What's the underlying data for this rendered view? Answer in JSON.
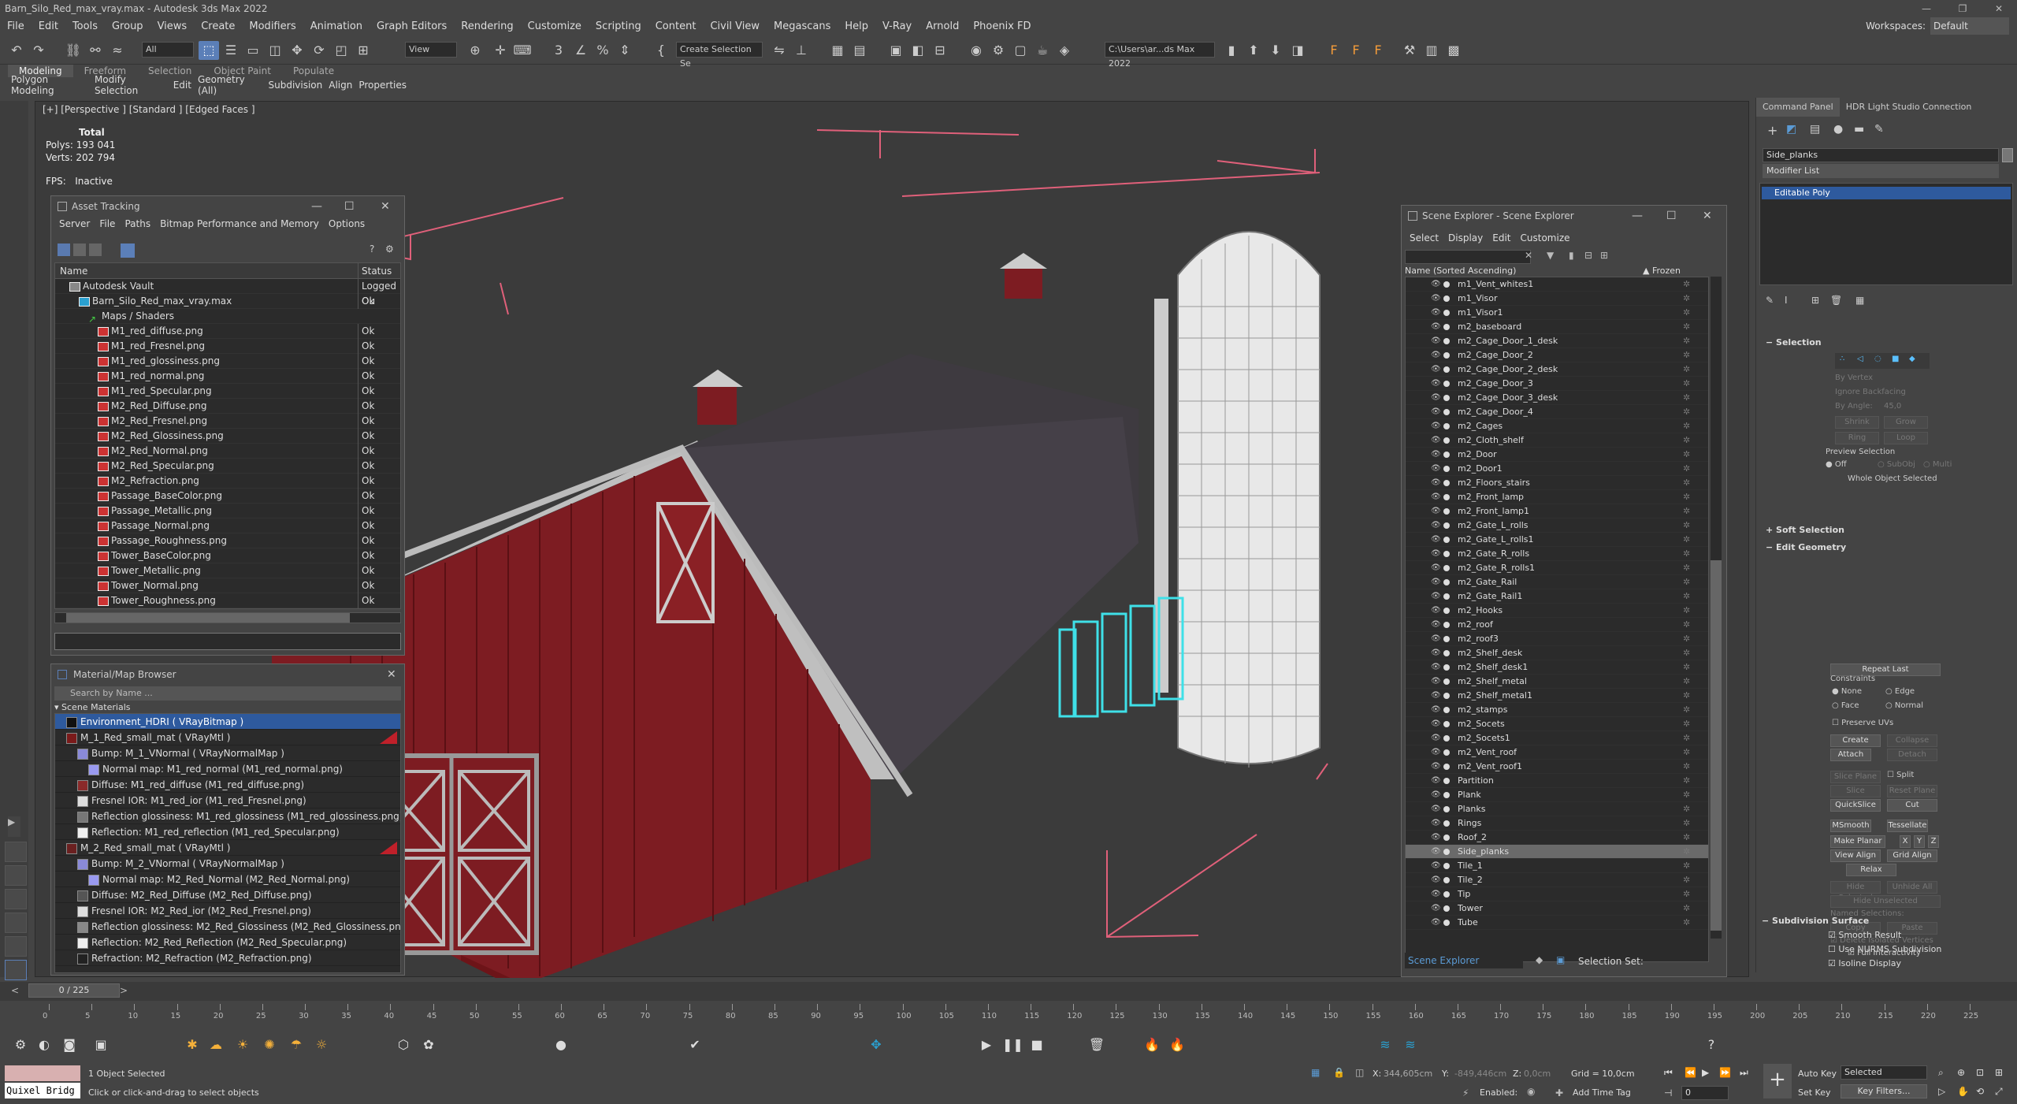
{
  "window": {
    "title": "Barn_Silo_Red_max_vray.max - Autodesk 3ds Max 2022",
    "minimize": "—",
    "maximize": "❐",
    "close": "✕"
  },
  "menu": [
    "File",
    "Edit",
    "Tools",
    "Group",
    "Views",
    "Create",
    "Modifiers",
    "Animation",
    "Graph Editors",
    "Rendering",
    "Customize",
    "Scripting",
    "Content",
    "Civil View",
    "Megascans",
    "Help",
    "V-Ray",
    "Arnold",
    "Phoenix FD"
  ],
  "workspace": {
    "label": "Workspaces:",
    "value": "Default"
  },
  "toolbar": {
    "filter": "All",
    "view": "View",
    "selection_set": "Create Selection Se",
    "path": "C:\\Users\\ar...ds Max 2022"
  },
  "ribbon": {
    "tabs": [
      "Modeling",
      "Freeform",
      "Selection",
      "Object Paint",
      "Populate"
    ],
    "sub": [
      "Polygon Modeling",
      "Modify Selection",
      "Edit",
      "Geometry (All)",
      "Subdivision",
      "Align",
      "Properties"
    ]
  },
  "viewport": {
    "label": "[+] [Perspective ] [Standard ] [Edged Faces ]",
    "stats": {
      "header": "Total",
      "polys_label": "Polys:",
      "polys": "193 041",
      "verts_label": "Verts:",
      "verts": "202 794",
      "fps_label": "FPS:",
      "fps": "Inactive"
    }
  },
  "asset_tracking": {
    "title": "Asset Tracking",
    "menu": [
      "Server",
      "File",
      "Paths",
      "Bitmap Performance and Memory",
      "Options"
    ],
    "col_name": "Name",
    "col_status": "Status",
    "rows": [
      {
        "name": "Autodesk Vault",
        "status": "Logged Ou",
        "indent": 18,
        "type": "vault"
      },
      {
        "name": "Barn_Silo_Red_max_vray.max",
        "status": "Ok",
        "indent": 30,
        "type": "max"
      },
      {
        "name": "Maps / Shaders",
        "status": "",
        "indent": 42,
        "type": "folder"
      },
      {
        "name": "M1_red_diffuse.png",
        "status": "Ok",
        "indent": 54,
        "type": "file"
      },
      {
        "name": "M1_red_Fresnel.png",
        "status": "Ok",
        "indent": 54,
        "type": "file"
      },
      {
        "name": "M1_red_glossiness.png",
        "status": "Ok",
        "indent": 54,
        "type": "file"
      },
      {
        "name": "M1_red_normal.png",
        "status": "Ok",
        "indent": 54,
        "type": "file"
      },
      {
        "name": "M1_red_Specular.png",
        "status": "Ok",
        "indent": 54,
        "type": "file"
      },
      {
        "name": "M2_Red_Diffuse.png",
        "status": "Ok",
        "indent": 54,
        "type": "file"
      },
      {
        "name": "M2_Red_Fresnel.png",
        "status": "Ok",
        "indent": 54,
        "type": "file"
      },
      {
        "name": "M2_Red_Glossiness.png",
        "status": "Ok",
        "indent": 54,
        "type": "file"
      },
      {
        "name": "M2_Red_Normal.png",
        "status": "Ok",
        "indent": 54,
        "type": "file"
      },
      {
        "name": "M2_Red_Specular.png",
        "status": "Ok",
        "indent": 54,
        "type": "file"
      },
      {
        "name": "M2_Refraction.png",
        "status": "Ok",
        "indent": 54,
        "type": "file"
      },
      {
        "name": "Passage_BaseColor.png",
        "status": "Ok",
        "indent": 54,
        "type": "file"
      },
      {
        "name": "Passage_Metallic.png",
        "status": "Ok",
        "indent": 54,
        "type": "file"
      },
      {
        "name": "Passage_Normal.png",
        "status": "Ok",
        "indent": 54,
        "type": "file"
      },
      {
        "name": "Passage_Roughness.png",
        "status": "Ok",
        "indent": 54,
        "type": "file"
      },
      {
        "name": "Tower_BaseColor.png",
        "status": "Ok",
        "indent": 54,
        "type": "file"
      },
      {
        "name": "Tower_Metallic.png",
        "status": "Ok",
        "indent": 54,
        "type": "file"
      },
      {
        "name": "Tower_Normal.png",
        "status": "Ok",
        "indent": 54,
        "type": "file"
      },
      {
        "name": "Tower_Roughness.png",
        "status": "Ok",
        "indent": 54,
        "type": "file"
      }
    ]
  },
  "material_browser": {
    "title": "Material/Map Browser",
    "search": "Search by Name ...",
    "group": "Scene Materials",
    "rows": [
      {
        "text": "Environment_HDRI  ( VRayBitmap )",
        "indent": 14,
        "swatch": "#111111",
        "sel": true
      },
      {
        "text": "M_1_Red_small_mat  ( VRayMtl )",
        "indent": 14,
        "swatch": "#7a1a1a",
        "sel": false
      },
      {
        "text": "Bump: M_1_VNormal  ( VRayNormalMap )",
        "indent": 28,
        "swatch": "#8a8ad8",
        "sel": false
      },
      {
        "text": "Normal map: M1_red_normal (M1_red_normal.png)",
        "indent": 42,
        "swatch": "#9a9af0",
        "sel": false
      },
      {
        "text": "Diffuse: M1_red_diffuse (M1_red_diffuse.png)",
        "indent": 28,
        "swatch": "#8a2a2a",
        "sel": false
      },
      {
        "text": "Fresnel IOR: M1_red_ior (M1_red_Fresnel.png)",
        "indent": 28,
        "swatch": "#dddddd",
        "sel": false
      },
      {
        "text": "Reflection glossiness: M1_red_glossiness (M1_red_glossiness.png)",
        "indent": 28,
        "swatch": "#777777",
        "sel": false
      },
      {
        "text": "Reflection: M1_red_reflection (M1_red_Specular.png)",
        "indent": 28,
        "swatch": "#eeeeee",
        "sel": false
      },
      {
        "text": "M_2_Red_small_mat  ( VRayMtl )",
        "indent": 14,
        "swatch": "#6a2020",
        "sel": false
      },
      {
        "text": "Bump: M_2_VNormal  ( VRayNormalMap )",
        "indent": 28,
        "swatch": "#8a8ad8",
        "sel": false
      },
      {
        "text": "Normal map: M2_Red_Normal (M2_Red_Normal.png)",
        "indent": 42,
        "swatch": "#9a9af0",
        "sel": false
      },
      {
        "text": "Diffuse: M2_Red_Diffuse (M2_Red_Diffuse.png)",
        "indent": 28,
        "swatch": "#555555",
        "sel": false
      },
      {
        "text": "Fresnel IOR: M2_Red_ior (M2_Red_Fresnel.png)",
        "indent": 28,
        "swatch": "#dddddd",
        "sel": false
      },
      {
        "text": "Reflection glossiness: M2_Red_Glossiness (M2_Red_Glossiness.png)",
        "indent": 28,
        "swatch": "#888888",
        "sel": false
      },
      {
        "text": "Reflection: M2_Red_Reflection (M2_Red_Specular.png)",
        "indent": 28,
        "swatch": "#eeeeee",
        "sel": false
      },
      {
        "text": "Refraction: M2_Refraction (M2_Refraction.png)",
        "indent": 28,
        "swatch": "#222222",
        "sel": false
      }
    ]
  },
  "scene_explorer": {
    "title": "Scene Explorer - Scene Explorer",
    "menu": [
      "Select",
      "Display",
      "Edit",
      "Customize"
    ],
    "col_name": "Name (Sorted Ascending)",
    "col_frozen": "▲ Frozen",
    "items": [
      "m1_Vent_whites1",
      "m1_Visor",
      "m1_Visor1",
      "m2_baseboard",
      "m2_Cage_Door_1_desk",
      "m2_Cage_Door_2",
      "m2_Cage_Door_2_desk",
      "m2_Cage_Door_3",
      "m2_Cage_Door_3_desk",
      "m2_Cage_Door_4",
      "m2_Cages",
      "m2_Cloth_shelf",
      "m2_Door",
      "m2_Door1",
      "m2_Floors_stairs",
      "m2_Front_lamp",
      "m2_Front_lamp1",
      "m2_Gate_L_rolls",
      "m2_Gate_L_rolls1",
      "m2_Gate_R_rolls",
      "m2_Gate_R_rolls1",
      "m2_Gate_Rail",
      "m2_Gate_Rail1",
      "m2_Hooks",
      "m2_roof",
      "m2_roof3",
      "m2_Shelf_desk",
      "m2_Shelf_desk1",
      "m2_Shelf_metal",
      "m2_Shelf_metal1",
      "m2_stamps",
      "m2_Socets",
      "m2_Socets1",
      "m2_Vent_roof",
      "m2_Vent_roof1",
      "Partition",
      "Plank",
      "Planks",
      "Rings",
      "Roof_2",
      "Side_planks",
      "Tile_1",
      "Tile_2",
      "Tip",
      "Tower",
      "Tube"
    ],
    "selected": "Side_planks",
    "footer": "Scene Explorer",
    "selection_set": "Selection Set:"
  },
  "command_panel": {
    "tabs": [
      "Command Panel",
      "HDR Light Studio Connection"
    ],
    "object_name": "Side_planks",
    "modifier_list": "Modifier List",
    "stack_item": "Editable Poly",
    "selection": {
      "title": "Selection",
      "by_vertex": "By Vertex",
      "ignore_backfacing": "Ignore Backfacing",
      "by_angle": "By Angle:",
      "angle": "45,0",
      "shrink": "Shrink",
      "grow": "Grow",
      "ring": "Ring",
      "loop": "Loop",
      "preview": "Preview Selection",
      "off": "Off",
      "subobj": "SubObj",
      "multi": "Multi",
      "status": "Whole Object Selected"
    },
    "soft_selection": "Soft Selection",
    "edit_geometry": {
      "title": "Edit Geometry",
      "repeat_last": "Repeat Last",
      "constraints": "Constraints",
      "none": "None",
      "edge": "Edge",
      "face": "Face",
      "normal": "Normal",
      "preserve_uvs": "Preserve UVs",
      "create": "Create",
      "collapse": "Collapse",
      "attach": "Attach",
      "detach": "Detach",
      "slice_plane": "Slice Plane",
      "split": "Split",
      "slice": "Slice",
      "reset_plane": "Reset Plane",
      "quickslice": "QuickSlice",
      "cut": "Cut",
      "msmooth": "MSmooth",
      "tessellate": "Tessellate",
      "make_planar": "Make Planar",
      "x": "X",
      "y": "Y",
      "z": "Z",
      "view_align": "View Align",
      "grid_align": "Grid Align",
      "relax": "Relax",
      "hide_selected": "Hide Selected",
      "unhide_all": "Unhide All",
      "hide_unselected": "Hide Unselected",
      "named_selections": "Named Selections:",
      "copy": "Copy",
      "paste": "Paste",
      "delete_isolated": "Delete Isolated Vertices",
      "full_interactivity": "Full Interactivity"
    },
    "subdivision": {
      "title": "Subdivision Surface",
      "smooth_result": "Smooth Result",
      "use_nurms": "Use NURMS Subdivision",
      "isoline": "Isoline Display"
    }
  },
  "timeline": {
    "frame": "0 / 225",
    "ticks": [
      "0",
      "5",
      "10",
      "15",
      "20",
      "25",
      "30",
      "35",
      "40",
      "45",
      "50",
      "55",
      "60",
      "65",
      "70",
      "75",
      "80",
      "85",
      "90",
      "95",
      "100",
      "105",
      "110",
      "115",
      "120",
      "125",
      "130",
      "135",
      "140",
      "145",
      "150",
      "155",
      "160",
      "165",
      "170",
      "175",
      "180",
      "185",
      "190",
      "195",
      "200",
      "205",
      "210",
      "215",
      "220",
      "225"
    ]
  },
  "status": {
    "quixel": "Quixel Bridg",
    "selected": "1 Object Selected",
    "hint": "Click or click-and-drag to select objects",
    "x_label": "X:",
    "x": "344,605cm",
    "y_label": "Y:",
    "y": "-849,446cm",
    "z_label": "Z:",
    "z": "0,0cm",
    "grid": "Grid = 10,0cm",
    "enabled": "Enabled:",
    "add_time_tag": "Add Time Tag",
    "auto_key": "Auto Key",
    "set_key": "Set Key",
    "selected_dd": "Selected",
    "key_filters": "Key Filters...",
    "frame_field": "0"
  },
  "colors": {
    "accent": "#5b7fb8",
    "barn_red": "#7d1c22",
    "selection_cyan": "#3fe0e8",
    "bbox_pink": "#e0607a"
  }
}
